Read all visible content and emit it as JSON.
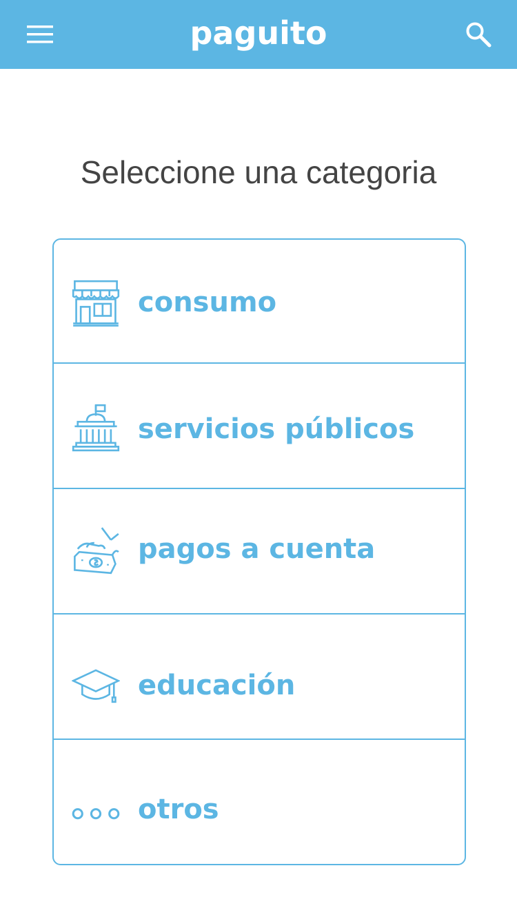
{
  "colors": {
    "header_bg": "#5cb6e3",
    "accent": "#5cb6e3",
    "title_text": "#444444",
    "background": "#ffffff"
  },
  "header": {
    "logo_text": "paguito",
    "menu_icon": "hamburger-menu-icon",
    "search_icon": "search-icon"
  },
  "main": {
    "title": "Seleccione una categoria",
    "categories": [
      {
        "label": "consumo",
        "icon": "storefront-icon"
      },
      {
        "label": "servicios públicos",
        "icon": "government-building-icon"
      },
      {
        "label": "pagos a cuenta",
        "icon": "cash-payment-icon"
      },
      {
        "label": "educación",
        "icon": "graduation-cap-icon"
      },
      {
        "label": "otros",
        "icon": "more-dots-icon"
      }
    ]
  }
}
